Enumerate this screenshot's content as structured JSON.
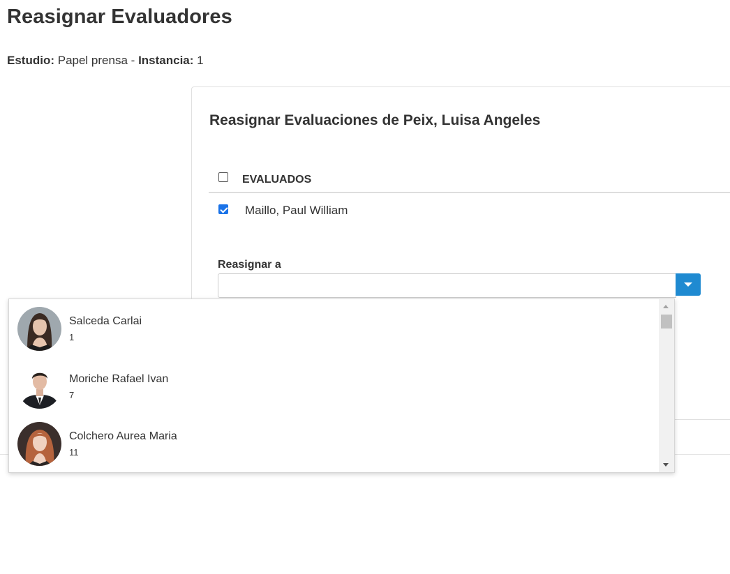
{
  "page": {
    "title": "Reasignar Evaluadores",
    "study_label": "Estudio:",
    "study_value": "Papel prensa",
    "separator": "-",
    "instance_label": "Instancia:",
    "instance_value": "1"
  },
  "card": {
    "title": "Reasignar Evaluaciones de Peix, Luisa Angeles",
    "table": {
      "header": "EVALUADOS",
      "header_checked": false,
      "rows": [
        {
          "label": "Maillo, Paul William",
          "checked": true
        }
      ]
    },
    "reassign": {
      "label": "Reasignar a",
      "value": ""
    }
  },
  "dropdown": {
    "options": [
      {
        "name": "Salceda Carlai",
        "count": "1",
        "avatar": "woman-dark-hair-avatar"
      },
      {
        "name": "Moriche Rafael Ivan",
        "count": "7",
        "avatar": "man-suit-avatar"
      },
      {
        "name": "Colchero Aurea Maria",
        "count": "11",
        "avatar": "woman-red-hair-avatar"
      }
    ]
  },
  "colors": {
    "accent": "#1f8ad1",
    "checkbox_checked": "#1a73e8",
    "text": "#333333"
  }
}
